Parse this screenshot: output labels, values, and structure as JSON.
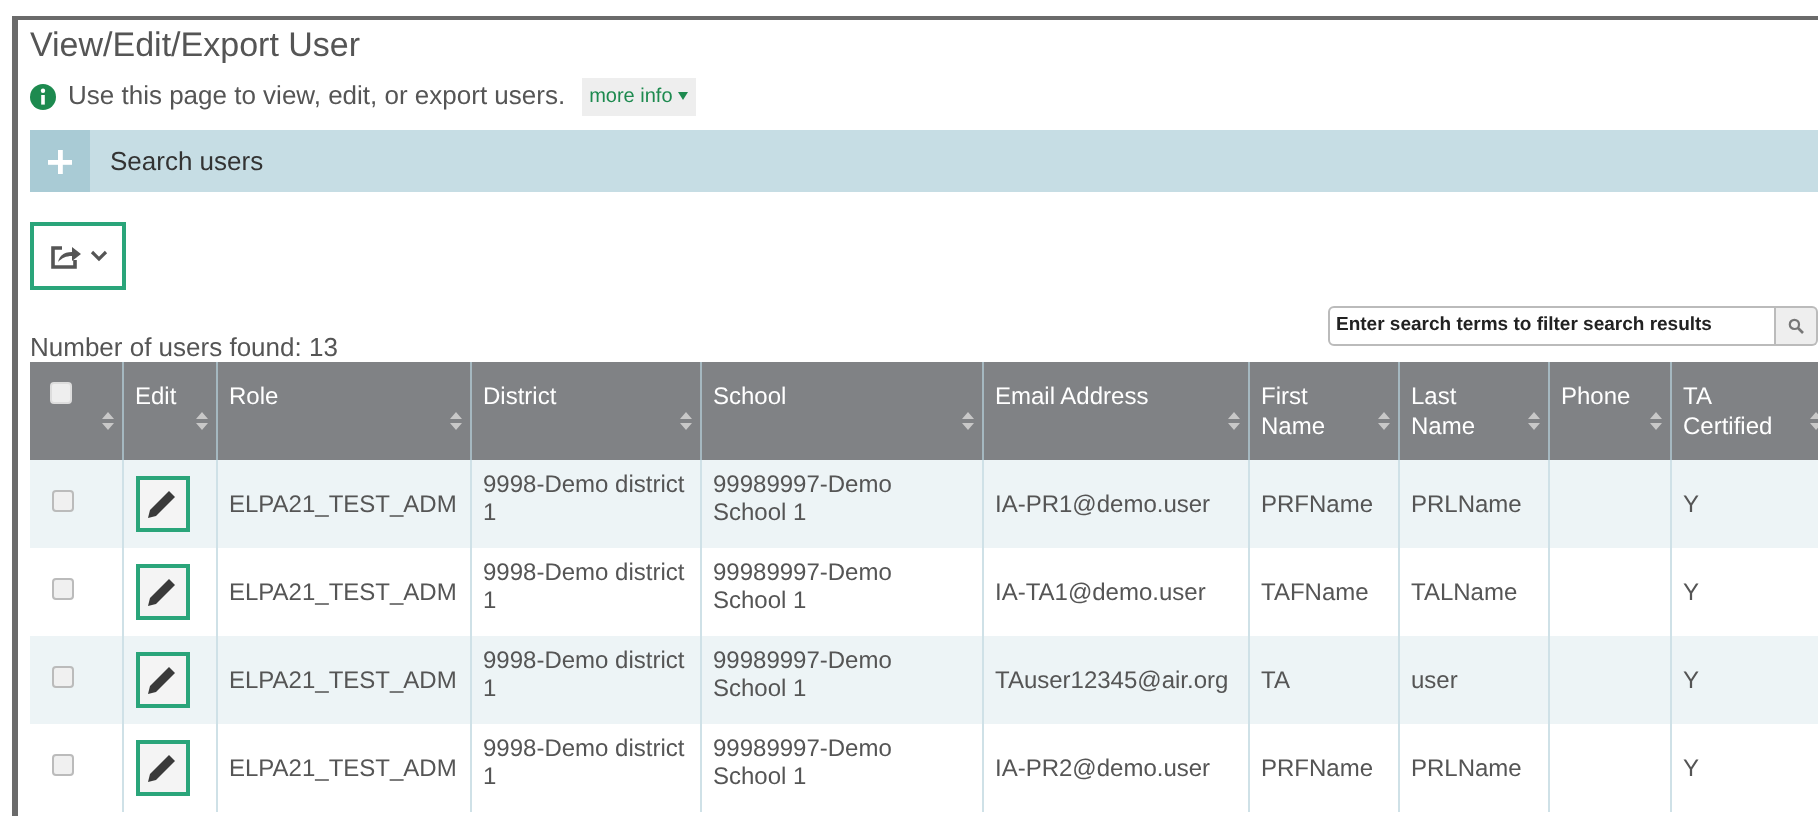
{
  "page": {
    "title": "View/Edit/Export User",
    "info": "Use this page to view, edit, or export users.",
    "more_info": "more info"
  },
  "search_panel": {
    "label": "Search users",
    "expanded": false
  },
  "results": {
    "count_label": "Number of users found: 13",
    "filter": {
      "placeholder": "Enter search terms to filter search results"
    }
  },
  "table": {
    "select_all": {
      "checked": false
    },
    "columns": [
      "Edit",
      "Role",
      "District",
      "School",
      "Email Address",
      "First Name",
      "Last Name",
      "Phone",
      "TA Certified"
    ],
    "rows": [
      {
        "checked": false,
        "role": "ELPA21_TEST_ADM",
        "district": "9998-Demo district 1",
        "school": "99989997-Demo School 1",
        "email": "IA-PR1@demo.user",
        "first_name": "PRFName",
        "last_name": "PRLName",
        "phone": "",
        "ta_certified": "Y"
      },
      {
        "checked": false,
        "role": "ELPA21_TEST_ADM",
        "district": "9998-Demo district 1",
        "school": "99989997-Demo School 1",
        "email": "IA-TA1@demo.user",
        "first_name": "TAFName",
        "last_name": "TALName",
        "phone": "",
        "ta_certified": "Y"
      },
      {
        "checked": false,
        "role": "ELPA21_TEST_ADM",
        "district": "9998-Demo district 1",
        "school": "99989997-Demo School 1",
        "email": "TAuser12345@air.org",
        "first_name": "TA",
        "last_name": "user",
        "phone": "",
        "ta_certified": "Y"
      },
      {
        "checked": false,
        "role": "ELPA21_TEST_ADM",
        "district": "9998-Demo district 1",
        "school": "99989997-Demo School 1",
        "email": "IA-PR2@demo.user",
        "first_name": "PRFName",
        "last_name": "PRLName",
        "phone": "",
        "ta_certified": "Y"
      }
    ]
  }
}
